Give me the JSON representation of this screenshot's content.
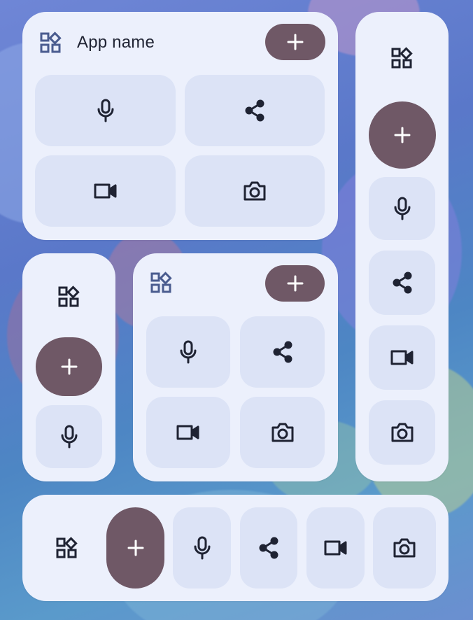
{
  "widget_large": {
    "app_name": "App name",
    "icons": [
      "apps-icon",
      "add-icon",
      "mic-icon",
      "share-icon",
      "videocam-icon",
      "camera-icon"
    ]
  },
  "colors": {
    "card_background": "#ecf0fc",
    "tile_background": "#dce3f6",
    "fab_background": "#6f5866",
    "icon_dark": "#1f2333",
    "icon_apps_tint": "#4a5c8f",
    "icon_on_fab": "#ffffff"
  }
}
